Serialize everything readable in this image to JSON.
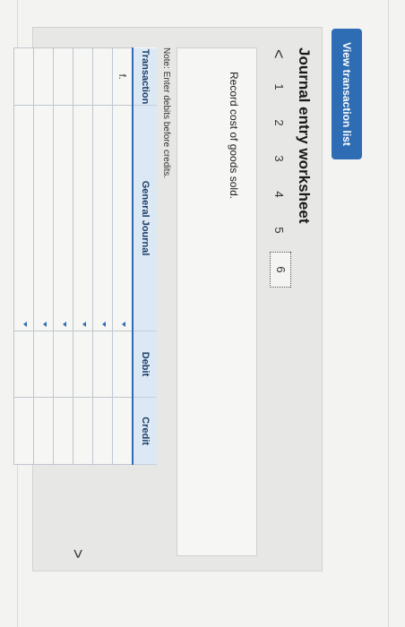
{
  "top_button": {
    "label": "View transaction list"
  },
  "worksheet": {
    "title": "Journal entry worksheet",
    "prev_arrow": "<",
    "next_arrow": ">",
    "steps": [
      "1",
      "2",
      "3",
      "4",
      "5",
      "6"
    ],
    "active_step": "6",
    "instruction": "Record cost of goods sold.",
    "note": "Note: Enter debits before credits."
  },
  "table": {
    "headers": [
      "Transaction",
      "General Journal",
      "Debit",
      "Credit"
    ],
    "first_transaction": "f."
  },
  "colors": {
    "accent": "#2e6db4",
    "header_bg": "#dce8f4"
  }
}
